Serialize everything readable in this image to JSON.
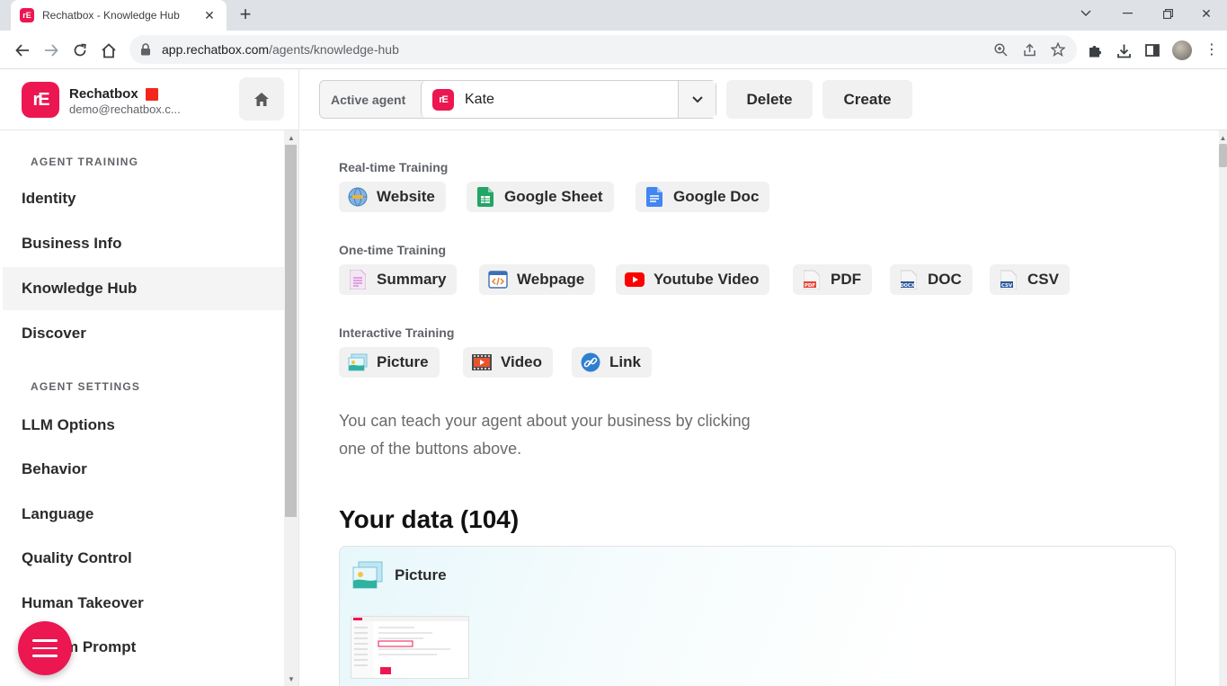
{
  "browser": {
    "tab_title": "Rechatbox - Knowledge Hub",
    "favicon_text": "rE",
    "url_host": "app.rechatbox.com",
    "url_path": "/agents/knowledge-hub"
  },
  "brand": {
    "name": "Rechatbox",
    "email": "demo@rechatbox.c...",
    "logo_text": "rE",
    "accent_color": "#ec1651"
  },
  "sidebar": {
    "training_label": "AGENT TRAINING",
    "training_items": [
      {
        "label": "Identity"
      },
      {
        "label": "Business Info"
      },
      {
        "label": "Knowledge Hub",
        "active": true
      },
      {
        "label": "Discover"
      }
    ],
    "settings_label": "AGENT SETTINGS",
    "settings_items": [
      {
        "label": "LLM Options"
      },
      {
        "label": "Behavior"
      },
      {
        "label": "Language"
      },
      {
        "label": "Quality Control"
      },
      {
        "label": "Human Takeover"
      },
      {
        "label": "m Prompt"
      }
    ]
  },
  "topbar": {
    "active_agent_label": "Active agent",
    "agent_name": "Kate",
    "delete_label": "Delete",
    "create_label": "Create"
  },
  "training": {
    "realtime_label": "Real-time Training",
    "realtime": [
      {
        "label": "Website",
        "icon": "globe-icon"
      },
      {
        "label": "Google Sheet",
        "icon": "google-sheet-icon"
      },
      {
        "label": "Google Doc",
        "icon": "google-doc-icon"
      }
    ],
    "onetime_label": "One-time Training",
    "onetime": [
      {
        "label": "Summary",
        "icon": "summary-icon"
      },
      {
        "label": "Webpage",
        "icon": "webpage-icon"
      },
      {
        "label": "Youtube Video",
        "icon": "youtube-icon"
      },
      {
        "label": "PDF",
        "icon": "pdf-icon"
      },
      {
        "label": "DOC",
        "icon": "doc-icon"
      },
      {
        "label": "CSV",
        "icon": "csv-icon"
      }
    ],
    "interactive_label": "Interactive Training",
    "interactive": [
      {
        "label": "Picture",
        "icon": "picture-icon"
      },
      {
        "label": "Video",
        "icon": "video-icon"
      },
      {
        "label": "Link",
        "icon": "link-icon"
      }
    ],
    "helper_text": "You can teach your agent about your business by clicking one of the buttons above."
  },
  "data": {
    "title": "Your data (104)",
    "first_item_type": "Picture"
  }
}
